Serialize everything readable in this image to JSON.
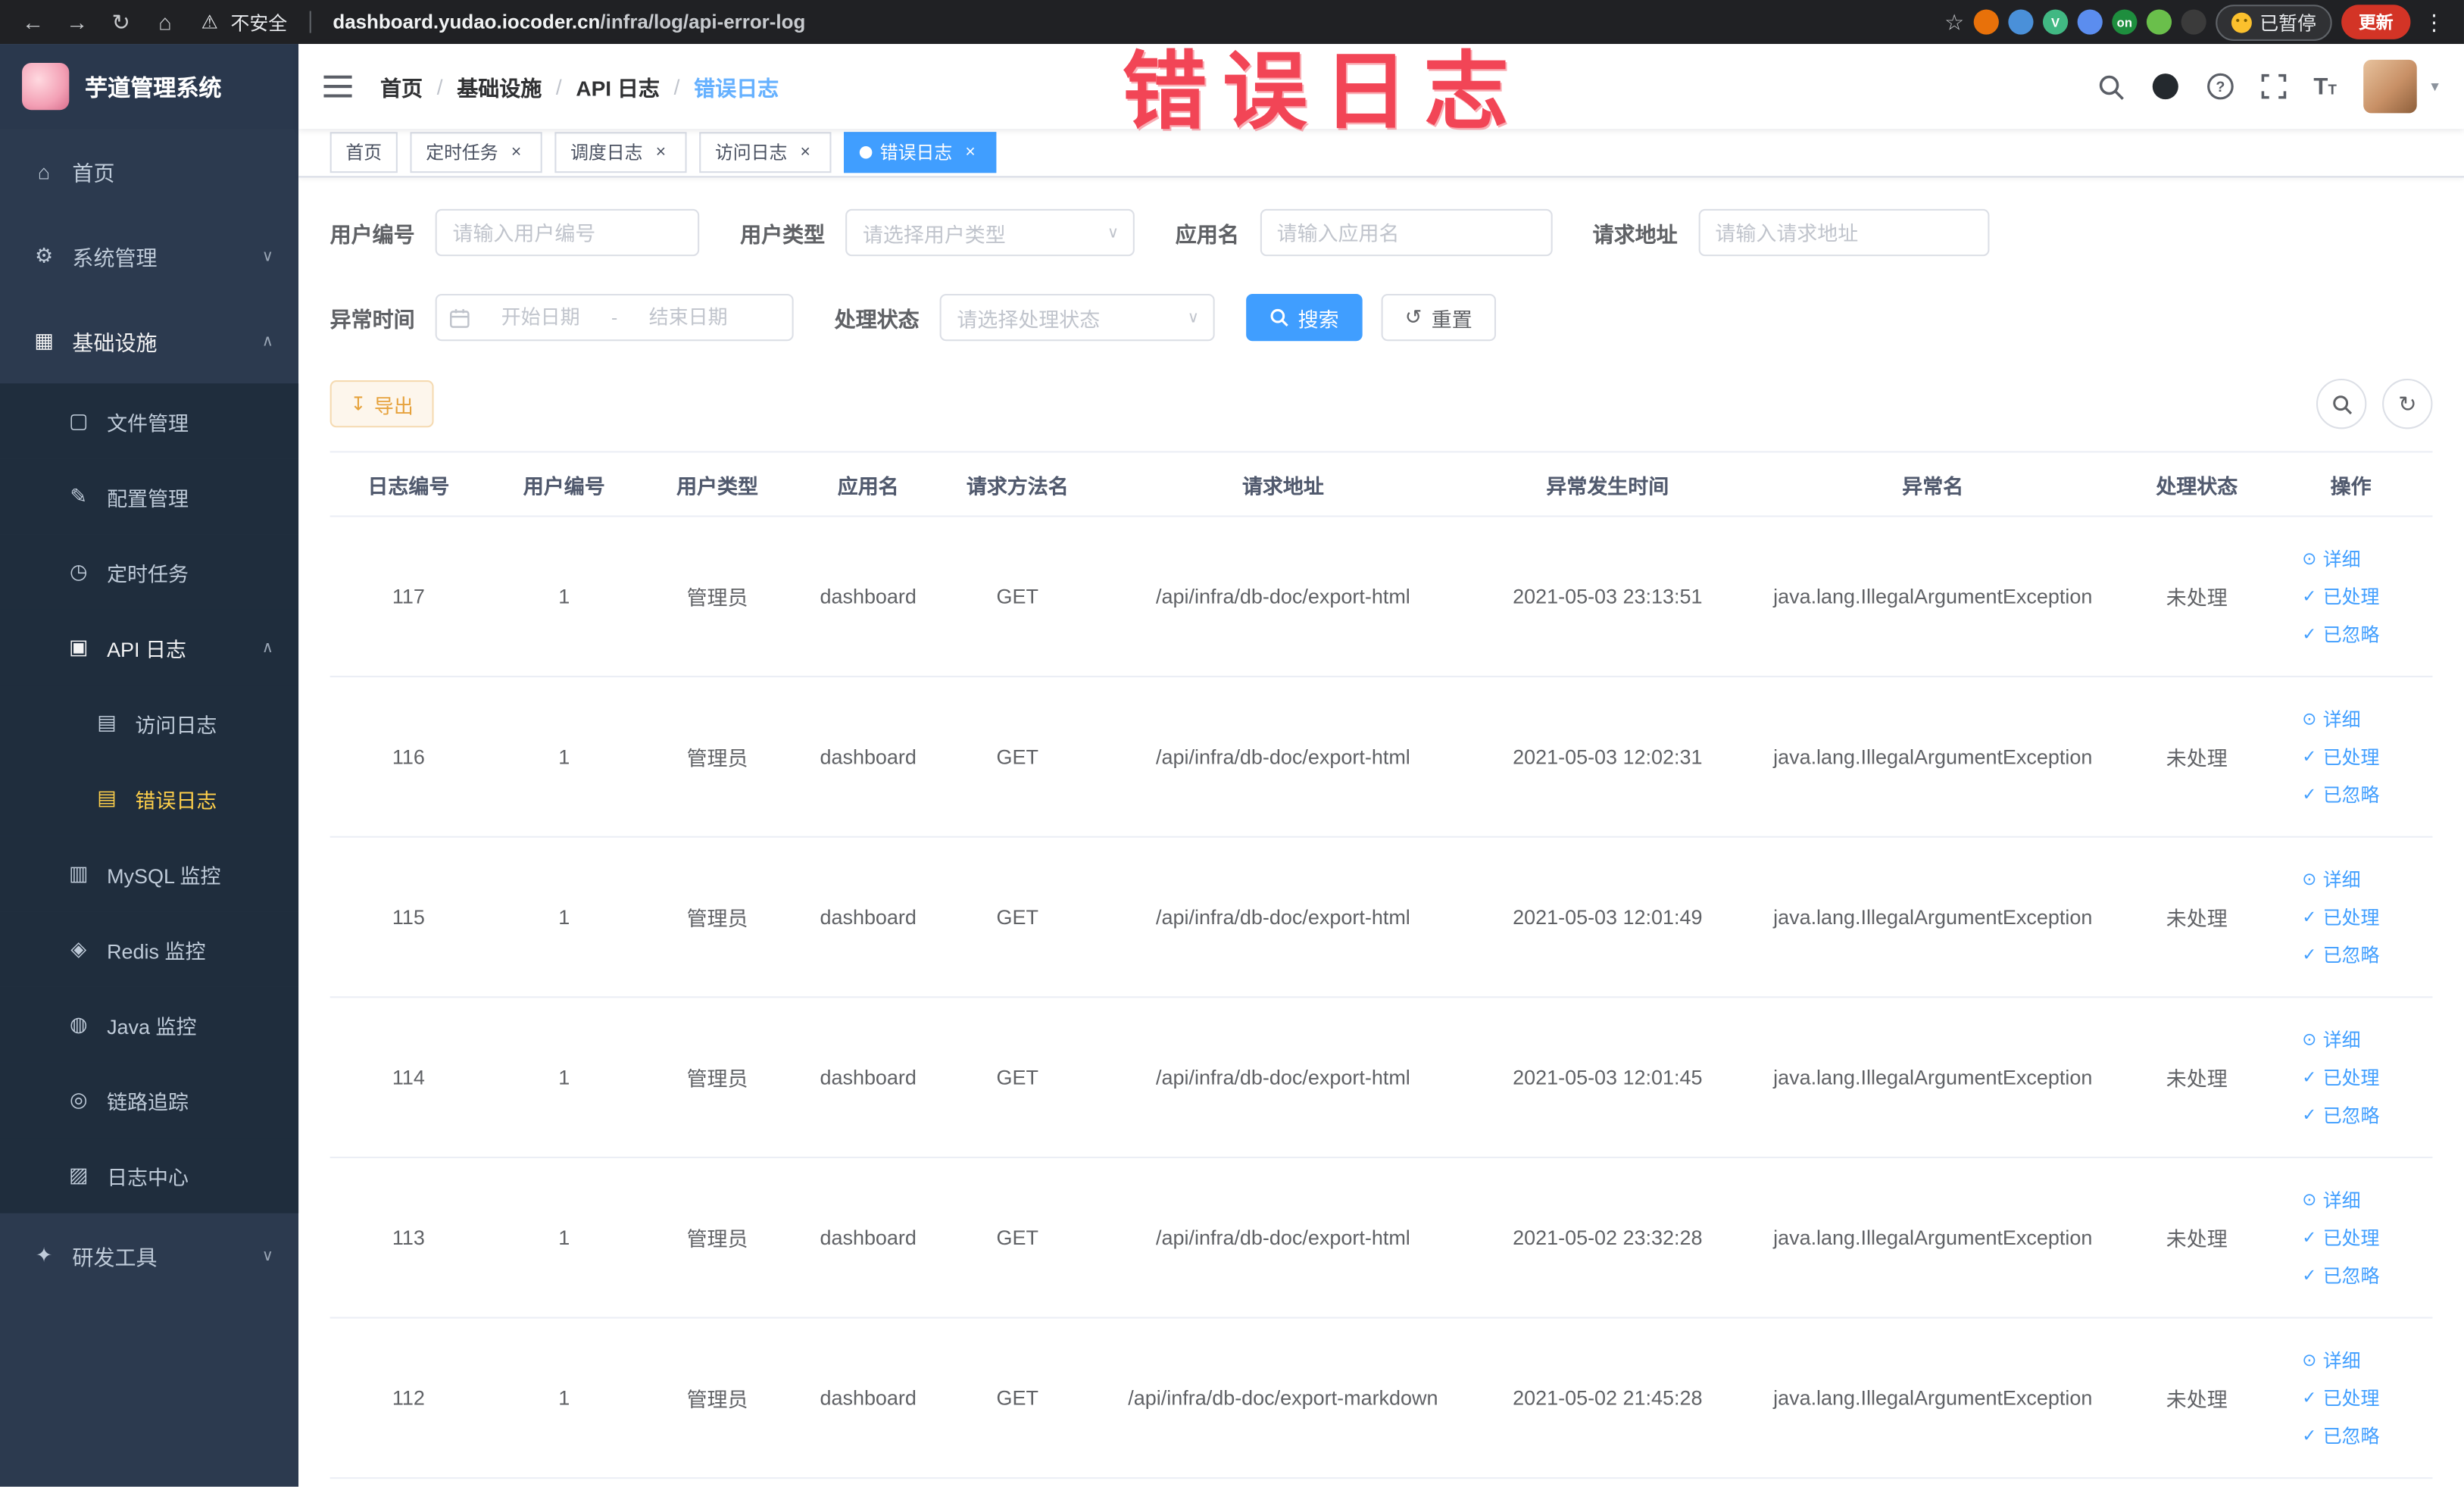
{
  "browser": {
    "security_label": "不安全",
    "url_domain": "dashboard.yudao.iocoder.cn",
    "url_path": "/infra/log/api-error-log",
    "paused_label": "已暂停",
    "update_label": "更新",
    "extensions": [
      {
        "name": "adblock-icon",
        "color": "#e8710a",
        "label": ""
      },
      {
        "name": "eyedropper-icon",
        "color": "#4a90d9",
        "label": ""
      },
      {
        "name": "vue-devtools-icon",
        "color": "#41b883",
        "label": "V"
      },
      {
        "name": "extensions-grid-icon",
        "color": "#5b8def",
        "label": ""
      },
      {
        "name": "proxy-on-icon",
        "color": "#1e8e3e",
        "label": "on"
      },
      {
        "name": "evernote-icon",
        "color": "#6abf4b",
        "label": ""
      },
      {
        "name": "octotree-icon",
        "color": "#3b3b3b",
        "label": ""
      }
    ]
  },
  "overlay": {
    "title": "错误日志",
    "color": "#f23c4e"
  },
  "sidebar": {
    "logo_title": "芋道管理系统",
    "items": [
      {
        "label": "首页",
        "icon_name": "home-icon",
        "glyph": "⌂",
        "cls": "top",
        "arrow": ""
      },
      {
        "label": "系统管理",
        "icon_name": "system-gear-icon",
        "glyph": "⚙",
        "cls": "top",
        "arrow": "down"
      },
      {
        "label": "基础设施",
        "icon_name": "infrastructure-icon",
        "glyph": "▦",
        "cls": "top expanded",
        "arrow": "up"
      },
      {
        "label": "文件管理",
        "icon_name": "file-manage-icon",
        "glyph": "▢",
        "cls": "sub",
        "arrow": ""
      },
      {
        "label": "配置管理",
        "icon_name": "config-manage-icon",
        "glyph": "✎",
        "cls": "sub",
        "arrow": ""
      },
      {
        "label": "定时任务",
        "icon_name": "timer-task-icon",
        "glyph": "◷",
        "cls": "sub",
        "arrow": ""
      },
      {
        "label": "API 日志",
        "icon_name": "api-log-icon",
        "glyph": "▣",
        "cls": "sub expanded",
        "arrow": "up"
      },
      {
        "label": "访问日志",
        "icon_name": "access-log-icon",
        "glyph": "▤",
        "cls": "nested",
        "arrow": ""
      },
      {
        "label": "错误日志",
        "icon_name": "error-log-icon",
        "glyph": "▤",
        "cls": "nested active",
        "arrow": ""
      },
      {
        "label": "MySQL 监控",
        "icon_name": "mysql-monitor-icon",
        "glyph": "▥",
        "cls": "sub",
        "arrow": ""
      },
      {
        "label": "Redis 监控",
        "icon_name": "redis-monitor-icon",
        "glyph": "◈",
        "cls": "sub",
        "arrow": ""
      },
      {
        "label": "Java 监控",
        "icon_name": "java-monitor-icon",
        "glyph": "◍",
        "cls": "sub",
        "arrow": ""
      },
      {
        "label": "链路追踪",
        "icon_name": "trace-icon",
        "glyph": "◎",
        "cls": "sub",
        "arrow": ""
      },
      {
        "label": "日志中心",
        "icon_name": "log-center-icon",
        "glyph": "▨",
        "cls": "sub",
        "arrow": ""
      },
      {
        "label": "研发工具",
        "icon_name": "dev-tools-icon",
        "glyph": "✦",
        "cls": "top",
        "arrow": "down"
      }
    ]
  },
  "header": {
    "breadcrumb": [
      {
        "label": "首页"
      },
      {
        "label": "基础设施"
      },
      {
        "label": "API 日志"
      },
      {
        "label": "错误日志"
      }
    ],
    "breadcrumb_separator": "/"
  },
  "tabs": [
    {
      "label": "首页",
      "closable": false,
      "cls": ""
    },
    {
      "label": "定时任务",
      "closable": true,
      "cls": ""
    },
    {
      "label": "调度日志",
      "closable": true,
      "cls": ""
    },
    {
      "label": "访问日志",
      "closable": true,
      "cls": ""
    },
    {
      "label": "错误日志",
      "closable": true,
      "cls": "active"
    }
  ],
  "filters": {
    "user_id_label": "用户编号",
    "user_id_placeholder": "请输入用户编号",
    "user_type_label": "用户类型",
    "user_type_placeholder": "请选择用户类型",
    "app_name_label": "应用名",
    "app_name_placeholder": "请输入应用名",
    "request_url_label": "请求地址",
    "request_url_placeholder": "请输入请求地址",
    "time_label": "异常时间",
    "time_start_placeholder": "开始日期",
    "time_separator": "-",
    "time_end_placeholder": "结束日期",
    "status_label": "处理状态",
    "status_placeholder": "请选择处理状态",
    "search_button": "搜索",
    "reset_button": "重置"
  },
  "toolbar": {
    "export_button": "导出"
  },
  "table": {
    "columns": [
      "日志编号",
      "用户编号",
      "用户类型",
      "应用名",
      "请求方法名",
      "请求地址",
      "异常发生时间",
      "异常名",
      "处理状态",
      "操作"
    ],
    "action_detail": "详细",
    "action_processed": "已处理",
    "action_ignored": "已忽略",
    "rows": [
      {
        "id": "117",
        "user_id": "1",
        "user_type": "管理员",
        "app_name": "dashboard",
        "method": "GET",
        "url": "/api/infra/db-doc/export-html",
        "time": "2021-05-03 23:13:51",
        "exception": "java.lang.IllegalArgumentException",
        "status": "未处理"
      },
      {
        "id": "116",
        "user_id": "1",
        "user_type": "管理员",
        "app_name": "dashboard",
        "method": "GET",
        "url": "/api/infra/db-doc/export-html",
        "time": "2021-05-03 12:02:31",
        "exception": "java.lang.IllegalArgumentException",
        "status": "未处理"
      },
      {
        "id": "115",
        "user_id": "1",
        "user_type": "管理员",
        "app_name": "dashboard",
        "method": "GET",
        "url": "/api/infra/db-doc/export-html",
        "time": "2021-05-03 12:01:49",
        "exception": "java.lang.IllegalArgumentException",
        "status": "未处理"
      },
      {
        "id": "114",
        "user_id": "1",
        "user_type": "管理员",
        "app_name": "dashboard",
        "method": "GET",
        "url": "/api/infra/db-doc/export-html",
        "time": "2021-05-03 12:01:45",
        "exception": "java.lang.IllegalArgumentException",
        "status": "未处理"
      },
      {
        "id": "113",
        "user_id": "1",
        "user_type": "管理员",
        "app_name": "dashboard",
        "method": "GET",
        "url": "/api/infra/db-doc/export-html",
        "time": "2021-05-02 23:32:28",
        "exception": "java.lang.IllegalArgumentException",
        "status": "未处理"
      },
      {
        "id": "112",
        "user_id": "1",
        "user_type": "管理员",
        "app_name": "dashboard",
        "method": "GET",
        "url": "/api/infra/db-doc/export-markdown",
        "time": "2021-05-02 21:45:28",
        "exception": "java.lang.IllegalArgumentException",
        "status": "未处理"
      }
    ]
  }
}
